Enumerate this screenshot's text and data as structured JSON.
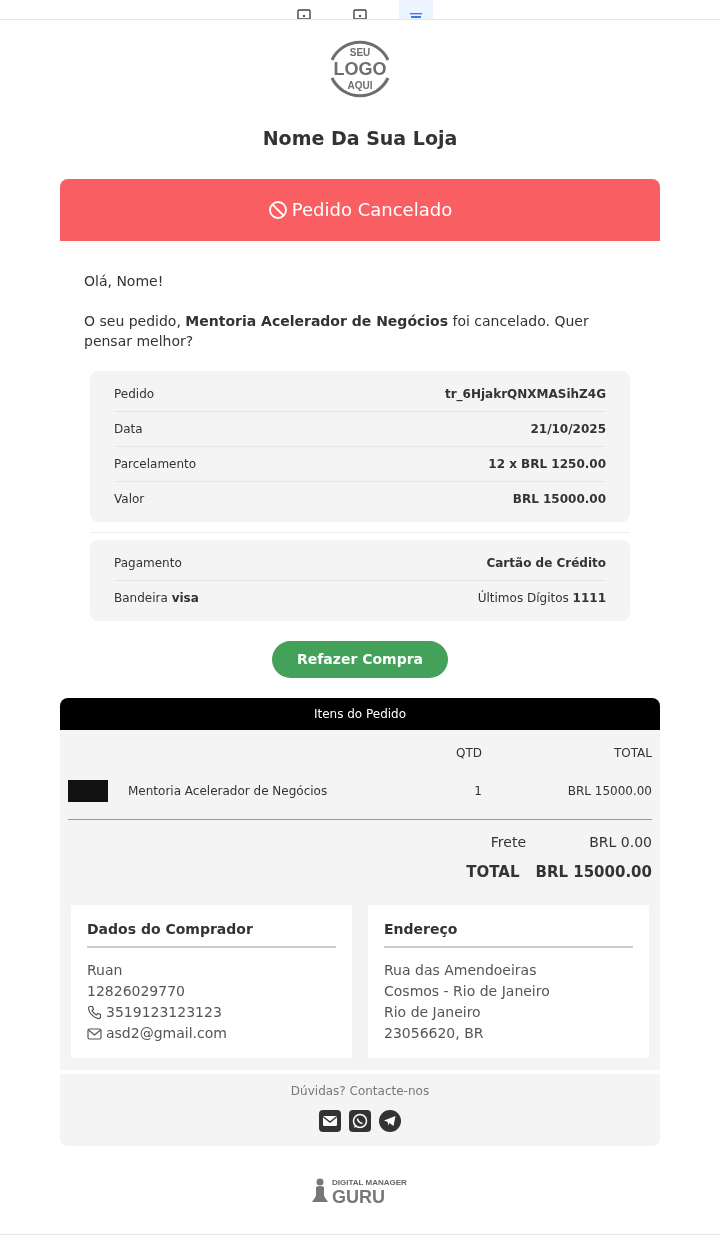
{
  "toolbar": [
    {
      "kind": "desktop",
      "selected": false
    },
    {
      "kind": "tablet",
      "selected": false
    },
    {
      "kind": "mobile",
      "selected": true
    }
  ],
  "store": {
    "logo_lines": [
      "SEU",
      "LOGO",
      "AQUI"
    ],
    "name": "Nome Da Sua Loja"
  },
  "banner": {
    "title": "Pedido Cancelado"
  },
  "greeting": "Olá, Nome!",
  "message": "O seu pedido, **Mentoria Acelerador de Negócios** foi cancelado. Quer pensar melhor?",
  "order_summary": [
    {
      "label": "Pedido",
      "value": "tr_6HjakrQNXMASihZ4G"
    },
    {
      "label": "Data",
      "value": "21/10/2025"
    },
    {
      "label": "Parcelamento",
      "value": "12 x BRL 1250.00"
    },
    {
      "label": "Valor",
      "value": "BRL 15000.00"
    }
  ],
  "payment": [
    {
      "label": "Pagamento",
      "value": "Cartão de Crédito",
      "bold_value": true
    },
    {
      "label": "Bandeira **visa**",
      "value": "Últimos Dígitos **1111**",
      "bold_value": false
    }
  ],
  "button": "Refazer Compra",
  "items": {
    "title": "Itens do Pedido",
    "columns": [
      "QTD",
      "TOTAL"
    ],
    "rows": [
      {
        "name": "Mentoria Acelerador de Negócios",
        "qty": "1",
        "total": "BRL 15000.00"
      }
    ],
    "shipping": {
      "label": "Frete",
      "value": "BRL 0.00"
    },
    "total": {
      "label": "TOTAL",
      "value": "BRL 15000.00"
    }
  },
  "buyer": {
    "title": "Dados do Comprador",
    "lines": [
      {
        "kind": "text",
        "text": "Ruan"
      },
      {
        "kind": "text",
        "text": "12826029770"
      },
      {
        "kind": "phone",
        "text": "3519123123123"
      },
      {
        "kind": "email",
        "text": "asd2@gmail.com"
      }
    ]
  },
  "address": {
    "title": "Endereço",
    "lines": [
      {
        "text": "Rua das Amendoeiras"
      },
      {
        "text": "Cosmos - Rio de Janeiro"
      },
      {
        "text": "Rio de Janeiro"
      },
      {
        "text": "23056620, BR"
      }
    ]
  },
  "footer": {
    "text": "Dúvidas? Contacte-nos",
    "contacts": [
      {
        "kind": "email"
      },
      {
        "kind": "whatsapp"
      },
      {
        "kind": "telegram"
      }
    ]
  },
  "brand": {
    "small": "DIGITAL MANAGER",
    "big": "GURU"
  }
}
